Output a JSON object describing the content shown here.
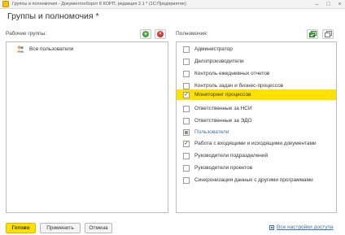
{
  "window": {
    "title": "Группы и полномочия - Документооборот 8 КОРП, редакция 2.1 * (1С:Предприятие)",
    "controls": {
      "minimize": "–",
      "maximize": "□",
      "close": "×"
    }
  },
  "form": {
    "title": "Группы и полномочия *"
  },
  "left": {
    "label": "Рабочие группы:",
    "add_icon": "+",
    "remove_icon": "×",
    "groups": [
      {
        "label": "Все пользователи"
      }
    ]
  },
  "right": {
    "label": "Полномочия:",
    "items": [
      {
        "label": "Администратор",
        "check": ""
      },
      {
        "label": "Делопроизводители",
        "check": ""
      },
      {
        "label": "Контроль ежедневных отчетов",
        "check": ""
      },
      {
        "label": "Контроль задач и бизнес-процессов",
        "check": ""
      },
      {
        "label": "Мониторинг процессов",
        "check": "✓"
      },
      {
        "label": "Ответственные за НСИ",
        "check": ""
      },
      {
        "label": "Ответственные за ЭДО",
        "check": ""
      },
      {
        "label": "Пользователи",
        "check": ""
      },
      {
        "label": "Работа с входящими и исходящими документами",
        "check": "✓"
      },
      {
        "label": "Руководители подразделений",
        "check": ""
      },
      {
        "label": "Руководители проектов",
        "check": ""
      },
      {
        "label": "Синхронизация данных с другими программами",
        "check": ""
      }
    ]
  },
  "footer": {
    "ok_label": "Готово",
    "apply_label": "Применить",
    "cancel_label": "Отмена",
    "settings_link": "Все настройки доступа"
  },
  "colors": {
    "accent": "#ffe100",
    "link": "#3a73b5",
    "add": "#3fa535",
    "remove": "#d93333"
  }
}
